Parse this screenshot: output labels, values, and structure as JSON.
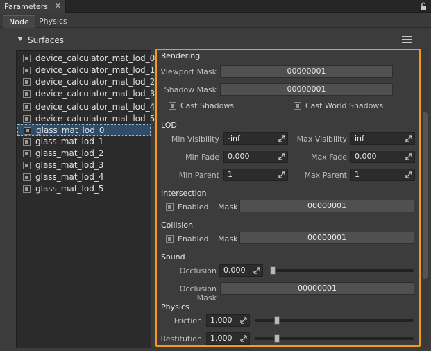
{
  "window": {
    "title": "Parameters",
    "close_glyph": "✕",
    "lock_icon": "lock-icon"
  },
  "tabs": [
    {
      "label": "Node",
      "active": true
    },
    {
      "label": "Physics",
      "active": false
    }
  ],
  "surfaces": {
    "title": "Surfaces",
    "items": [
      "device_calculator_mat_lod_0",
      "device_calculator_mat_lod_1",
      "device_calculator_mat_lod_2",
      "device_calculator_mat_lod_3",
      "device_calculator_mat_lod_4",
      "device_calculator_mat_lod_5",
      "glass_mat_lod_0",
      "glass_mat_lod_1",
      "glass_mat_lod_2",
      "glass_mat_lod_3",
      "glass_mat_lod_4",
      "glass_mat_lod_5"
    ],
    "selected": "glass_mat_lod_0"
  },
  "rendering": {
    "title": "Rendering",
    "viewport_mask_label": "Viewport Mask",
    "viewport_mask": "00000001",
    "shadow_mask_label": "Shadow Mask",
    "shadow_mask": "00000001",
    "cast_shadows": "Cast Shadows",
    "cast_world_shadows": "Cast World Shadows"
  },
  "lod": {
    "title": "LOD",
    "min_visibility_label": "Min Visibility",
    "min_visibility": "-inf",
    "max_visibility_label": "Max Visibility",
    "max_visibility": "inf",
    "min_fade_label": "Min Fade",
    "min_fade": "0.000",
    "max_fade_label": "Max Fade",
    "max_fade": "0.000",
    "min_parent_label": "Min Parent",
    "min_parent": "1",
    "max_parent_label": "Max Parent",
    "max_parent": "1"
  },
  "intersection": {
    "title": "Intersection",
    "enabled_label": "Enabled",
    "mask_label": "Mask",
    "mask": "00000001"
  },
  "collision": {
    "title": "Collision",
    "enabled_label": "Enabled",
    "mask_label": "Mask",
    "mask": "00000001"
  },
  "sound": {
    "title": "Sound",
    "occlusion_label": "Occlusion",
    "occlusion": "0.000",
    "occlusion_level": 0.0,
    "occlusion_mask_label": "Occlusion Mask",
    "occlusion_mask": "00000001"
  },
  "physics": {
    "title": "Physics",
    "friction_label": "Friction",
    "friction": "1.000",
    "friction_level": 0.125,
    "restitution_label": "Restitution",
    "restitution": "1.000",
    "restitution_level": 0.125
  },
  "colors": {
    "accent": "#f39a1c",
    "selection": "#2f4d66"
  }
}
